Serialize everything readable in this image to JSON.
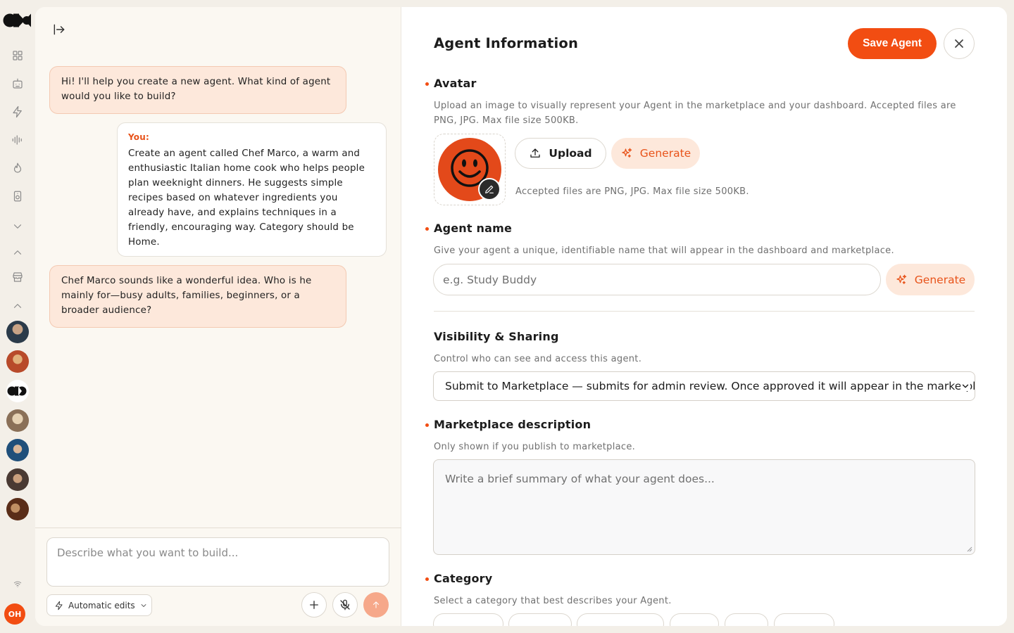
{
  "chat": {
    "messages": [
      {
        "role": "assistant",
        "text": "Hi! I'll help you create a new agent. What kind of agent would you like to build?"
      },
      {
        "role": "user",
        "label": "You:",
        "text": "Create an agent called Chef Marco, a warm and enthusiastic Italian home cook who helps people plan weeknight dinners. He suggests simple recipes based on whatever ingredients you already have, and explains techniques in a friendly, encouraging way. Category should be Home."
      },
      {
        "role": "assistant",
        "text": "Chef Marco sounds like a wonderful idea. Who is he mainly for—busy adults, families, beginners, or a broader audience?"
      }
    ],
    "composer_placeholder": "Describe what you want to build...",
    "auto_edits_label": "Automatic edits"
  },
  "form": {
    "title": "Agent Information",
    "save_label": "Save Agent",
    "avatar": {
      "title": "Avatar",
      "description": "Upload an image to visually represent your Agent in the marketplace and your dashboard. Accepted files are PNG, JPG. Max file size 500KB.",
      "upload_label": "Upload",
      "generate_label": "Generate",
      "hint": "Accepted files are PNG, JPG. Max file size 500KB."
    },
    "name": {
      "title": "Agent name",
      "description": "Give your agent a unique, identifiable name that will appear in the dashboard and marketplace.",
      "placeholder": "e.g. Study Buddy",
      "generate_label": "Generate"
    },
    "visibility": {
      "title": "Visibility & Sharing",
      "description": "Control who can see and access this agent.",
      "selected": "Submit to Marketplace — submits for admin review. Once approved it will appear in the marketplace"
    },
    "marketplace": {
      "title": "Marketplace description",
      "description": "Only shown if you publish to marketplace.",
      "placeholder": "Write a brief summary of what your agent does..."
    },
    "category": {
      "title": "Category",
      "description": "Select a category that best describes your Agent."
    }
  },
  "user": {
    "initials": "OH"
  },
  "colors": {
    "accent": "#f24d12",
    "bubble": "#fde8db",
    "avatar": "#e3491a"
  },
  "icons": [
    "logo-icon",
    "grid-icon",
    "robot-icon",
    "bolt-icon",
    "waveform-icon",
    "flame-icon",
    "speaker-icon",
    "chevron-down-icon",
    "chevron-up-icon",
    "store-icon",
    "wifi-icon",
    "sidebar-collapse-icon",
    "plus-icon",
    "mic-off-icon",
    "arrow-up-icon",
    "upload-icon",
    "sparkle-icon",
    "pencil-icon",
    "close-icon"
  ]
}
